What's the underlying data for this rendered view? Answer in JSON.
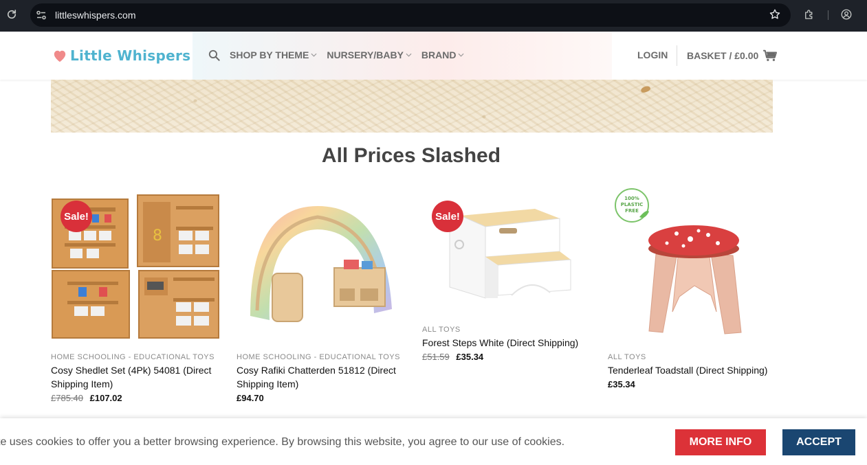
{
  "browser": {
    "url": "littleswhispers.com"
  },
  "header": {
    "logo_text": "Little Whispers",
    "nav": [
      {
        "label": "SHOP BY THEME"
      },
      {
        "label": "NURSERY/BABY"
      },
      {
        "label": "BRAND"
      }
    ],
    "login_label": "LOGIN",
    "basket_label": "BASKET / £0.00"
  },
  "main": {
    "section_title": "All Prices Slashed",
    "products": [
      {
        "badge": "Sale!",
        "category": "HOME SCHOOLING - EDUCATIONAL TOYS",
        "name": "Cosy Shedlet Set (4Pk) 54081 (Direct Shipping Item)",
        "old_price": "£785.40",
        "price": "£107.02"
      },
      {
        "badge": "",
        "category": "HOME SCHOOLING - EDUCATIONAL TOYS",
        "name": "Cosy Rafiki Chatterden 51812 (Direct Shipping Item)",
        "old_price": "",
        "price": "£94.70"
      },
      {
        "badge": "Sale!",
        "category": "ALL TOYS",
        "name": "Forest Steps White (Direct Shipping)",
        "old_price": "£51.59",
        "price": "£35.34"
      },
      {
        "badge": "100% PLASTIC FREE",
        "category": "ALL TOYS",
        "name": "Tenderleaf Toadstall (Direct Shipping)",
        "old_price": "",
        "price": "£35.34"
      }
    ]
  },
  "cookie_bar": {
    "text": "te uses cookies to offer you a better browsing experience. By browsing this website, you agree to our use of cookies.",
    "more_info_label": "MORE INFO",
    "accept_label": "ACCEPT"
  },
  "colors": {
    "sale_red": "#d9303a",
    "more_info_red": "#dc3238",
    "accept_blue": "#1a4671",
    "logo_blue": "#4fb3cf",
    "logo_heart": "#f08a8a"
  }
}
